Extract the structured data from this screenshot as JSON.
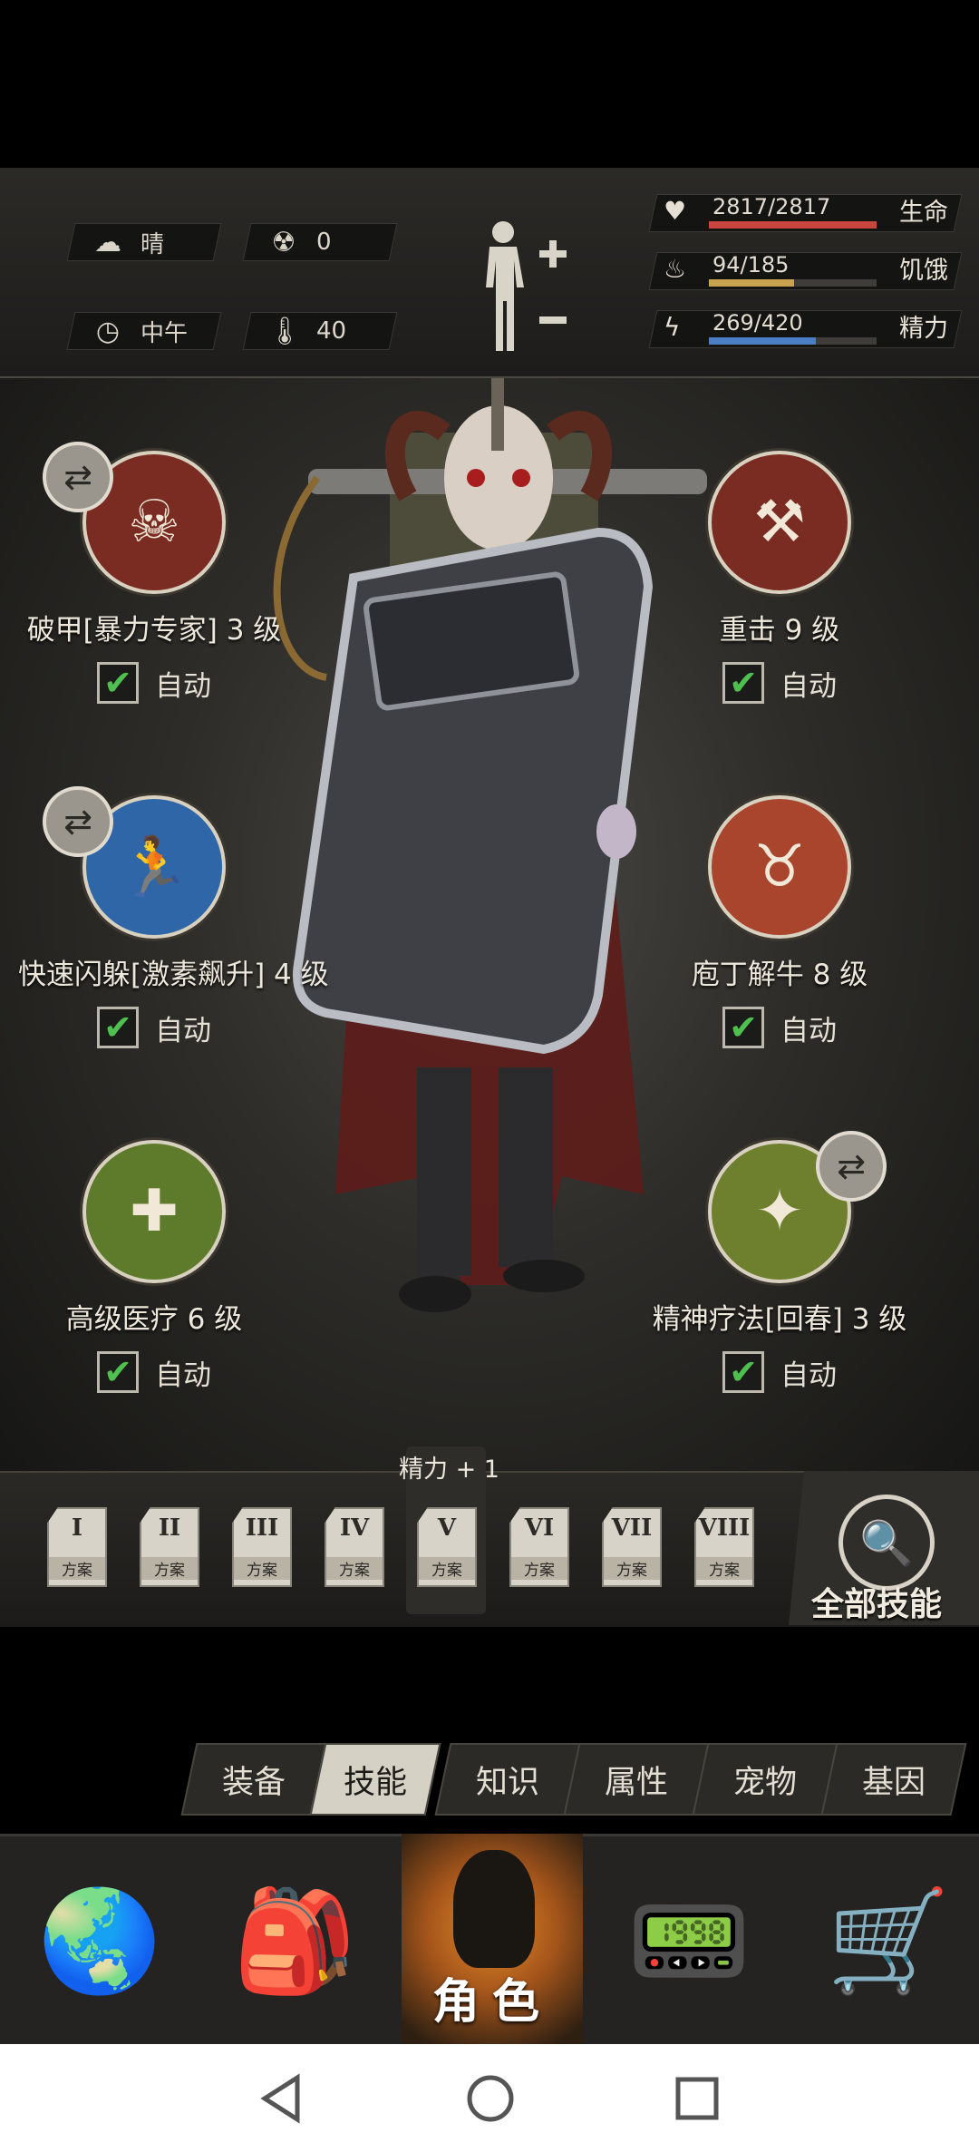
{
  "status": {
    "weather": "晴",
    "radiation": "0",
    "time_of_day": "中午",
    "temperature": "40"
  },
  "stats": [
    {
      "icon": "heart-icon",
      "value": "2817/2817",
      "label": "生命",
      "fraction": 1.0,
      "color": "#c9463f"
    },
    {
      "icon": "stomach-icon",
      "value": "94/185",
      "label": "饥饿",
      "fraction": 0.51,
      "color": "#c8a24e"
    },
    {
      "icon": "energy-icon",
      "value": "269/420",
      "label": "精力",
      "fraction": 0.64,
      "color": "#4b7fc4"
    }
  ],
  "skills": [
    {
      "name": "破甲[暴力专家] 3 级",
      "auto": "自动",
      "icon": "skull-dice-icon",
      "checked": true
    },
    {
      "name": "重击 9 级",
      "auto": "自动",
      "icon": "heavy-strike-icon",
      "checked": true
    },
    {
      "name": "快速闪躲[激素飙升] 4 级",
      "auto": "自动",
      "icon": "dodge-icon",
      "checked": true
    },
    {
      "name": "庖丁解牛 8 级",
      "auto": "自动",
      "icon": "bull-skull-icon",
      "checked": true
    },
    {
      "name": "高级医疗 6 级",
      "auto": "自动",
      "icon": "medkit-icon",
      "checked": true
    },
    {
      "name": "精神疗法[回春] 3 级",
      "auto": "自动",
      "icon": "spirit-heal-icon",
      "checked": true
    }
  ],
  "plans": {
    "sub_label": "方案",
    "numerals": [
      "I",
      "II",
      "III",
      "IV",
      "V",
      "VI",
      "VII",
      "VIII"
    ],
    "active_index": 4,
    "active_bonus": "精力 + 1"
  },
  "all_skills_label": "全部技能",
  "tabs": [
    "装备",
    "技能",
    "知识",
    "属性",
    "宠物",
    "基因"
  ],
  "active_tab": "技能",
  "nav": {
    "role_label": "角色"
  }
}
